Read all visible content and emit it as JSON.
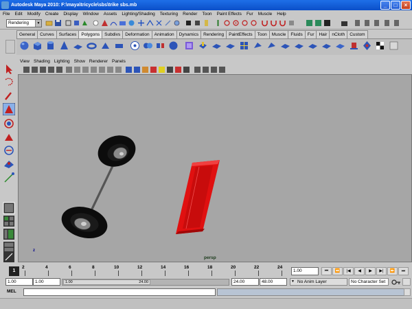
{
  "window": {
    "title": "Autodesk Maya 2010: F:\\maya\\tricycle\\sbs\\trike sbs.mb"
  },
  "menubar": [
    "File",
    "Edit",
    "Modify",
    "Create",
    "Display",
    "Window",
    "Assets",
    "Lighting/Shading",
    "Texturing",
    "Render",
    "Toon",
    "Paint Effects",
    "Fur",
    "Muscle",
    "Help"
  ],
  "statusline": {
    "mode": "Rendering"
  },
  "shelf_tabs": [
    "General",
    "Curves",
    "Surfaces",
    "Polygons",
    "Subdivs",
    "Deformation",
    "Animation",
    "Dynamics",
    "Rendering",
    "PaintEffects",
    "Toon",
    "Muscle",
    "Fluids",
    "Fur",
    "Hair",
    "nCloth",
    "Custom"
  ],
  "active_shelf_tab": "Polygons",
  "panel_menu": [
    "View",
    "Shading",
    "Lighting",
    "Show",
    "Renderer",
    "Panels"
  ],
  "viewport": {
    "camera": "persp",
    "axis_label": "z"
  },
  "timeline": {
    "ticks": [
      "2",
      "4",
      "6",
      "8",
      "10",
      "12",
      "14",
      "16",
      "18",
      "20",
      "22",
      "24"
    ],
    "current_frame_marker": "1",
    "current_time": "1.00"
  },
  "range": {
    "start": "1.00",
    "playback_start": "1.00",
    "handle_left": "1.00",
    "handle_right": "24.00",
    "playback_end": "24.00",
    "end": "48.00",
    "anim_layer": "No Anim Layer",
    "character_set": "No Character Set"
  },
  "command": {
    "label": "MEL"
  },
  "colors": {
    "title_bar": "#0b4fc9",
    "viewport_bg": "#a6a6a6",
    "board_red": "#e01010"
  }
}
